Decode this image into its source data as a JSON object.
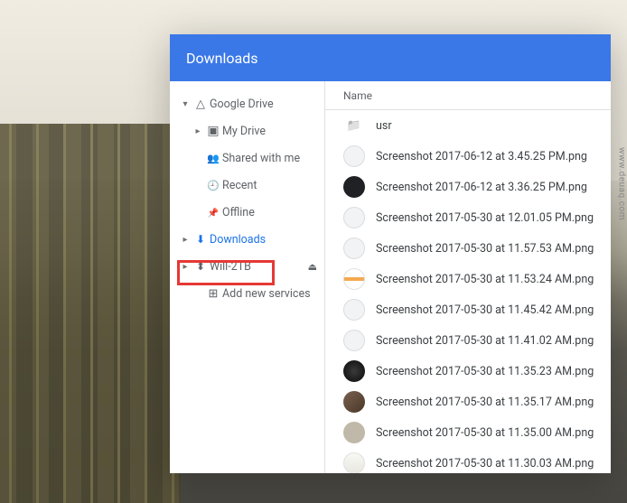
{
  "window": {
    "title": "Downloads"
  },
  "sidebar": {
    "items": [
      {
        "label": "Google Drive",
        "icon": "drive-icon",
        "depth": 0,
        "expanded": true,
        "accent": false
      },
      {
        "label": "My Drive",
        "icon": "mydrive-icon",
        "depth": 1,
        "expanded": false,
        "accent": false
      },
      {
        "label": "Shared with me",
        "icon": "shared-icon",
        "depth": 2,
        "expanded": null,
        "accent": false
      },
      {
        "label": "Recent",
        "icon": "recent-icon",
        "depth": 2,
        "expanded": null,
        "accent": false
      },
      {
        "label": "Offline",
        "icon": "offline-icon",
        "depth": 2,
        "expanded": null,
        "accent": false
      },
      {
        "label": "Downloads",
        "icon": "download-icon",
        "depth": 0,
        "expanded": false,
        "accent": true
      },
      {
        "label": "Will-2TB",
        "icon": "usb-icon",
        "depth": 0,
        "expanded": false,
        "accent": false,
        "ejectable": true,
        "highlighted": true
      },
      {
        "label": "Add new services",
        "icon": "add-icon",
        "depth": 2,
        "expanded": null,
        "accent": false
      }
    ]
  },
  "main": {
    "column_header": "Name",
    "files": [
      {
        "name": "usr",
        "thumb": "folder"
      },
      {
        "name": "Screenshot 2017-06-12 at 3.45.25 PM.png",
        "thumb": "white"
      },
      {
        "name": "Screenshot 2017-06-12 at 3.36.25 PM.png",
        "thumb": "dark"
      },
      {
        "name": "Screenshot 2017-05-30 at 12.01.05 PM.png",
        "thumb": "white"
      },
      {
        "name": "Screenshot 2017-05-30 at 11.57.53 AM.png",
        "thumb": "white"
      },
      {
        "name": "Screenshot 2017-05-30 at 11.53.24 AM.png",
        "thumb": "orange"
      },
      {
        "name": "Screenshot 2017-05-30 at 11.45.42 AM.png",
        "thumb": "white"
      },
      {
        "name": "Screenshot 2017-05-30 at 11.41.02 AM.png",
        "thumb": "white"
      },
      {
        "name": "Screenshot 2017-05-30 at 11.35.23 AM.png",
        "thumb": "dark2"
      },
      {
        "name": "Screenshot 2017-05-30 at 11.35.17 AM.png",
        "thumb": "photo"
      },
      {
        "name": "Screenshot 2017-05-30 at 11.35.00 AM.png",
        "thumb": "blur"
      },
      {
        "name": "Screenshot 2017-05-30 at 11.30.03 AM.png",
        "thumb": "light"
      }
    ]
  },
  "watermark": "www.deuaq.com"
}
